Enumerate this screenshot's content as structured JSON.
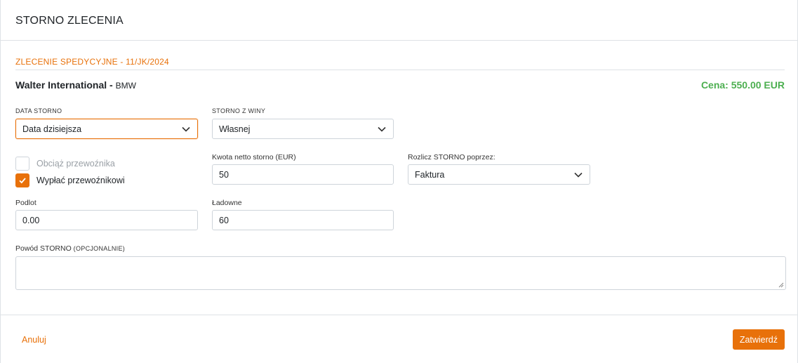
{
  "modal": {
    "title": "STORNO ZLECENIA"
  },
  "order": {
    "section_title": "ZLECENIE SPEDYCYJNE - 11/JK/2024",
    "client_name": "Walter International -",
    "client_sub": "BMW",
    "price": "Cena: 550.00 EUR"
  },
  "form": {
    "data_storno": {
      "label": "DATA STORNO",
      "value": "Data dzisiejsza"
    },
    "storno_z_winy": {
      "label": "STORNO Z WINY",
      "value": "Własnej"
    },
    "checkbox_charge": {
      "label": "Obciąż przewoźnika",
      "checked": false
    },
    "checkbox_pay": {
      "label": "Wypłać przewoźnikowi",
      "checked": true
    },
    "kwota": {
      "label": "Kwota netto storno (EUR)",
      "value": "50"
    },
    "rozlicz": {
      "label": "Rozlicz STORNO poprzez:",
      "value": "Faktura"
    },
    "podlot": {
      "label": "Podlot",
      "value": "0.00"
    },
    "ladowne": {
      "label": "Ładowne",
      "value": "60"
    },
    "powod": {
      "label": "Powód STORNO",
      "label_hint": "(OPCJONALNIE)",
      "value": ""
    }
  },
  "footer": {
    "cancel_label": "Anuluj",
    "confirm_label": "Zatwierdź"
  },
  "colors": {
    "accent": "#e8710a",
    "price": "#4caf50"
  },
  "icons": {
    "chevron": "chevron-down-icon",
    "check": "checkmark-icon"
  }
}
